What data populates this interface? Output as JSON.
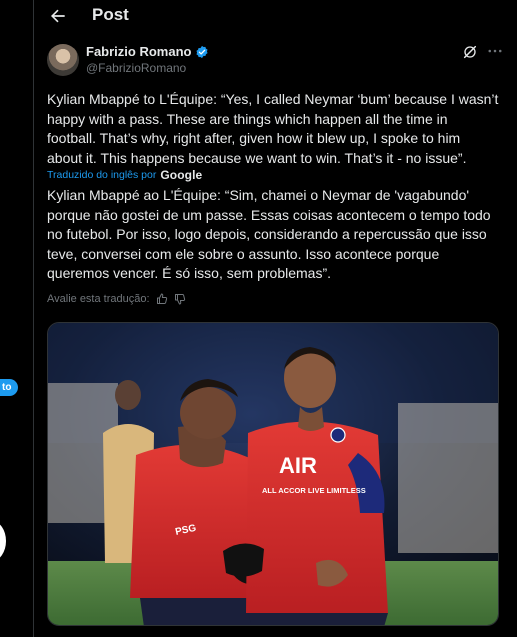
{
  "header": {
    "title": "Post"
  },
  "tweet": {
    "author_name": "Fabrizio Romano",
    "author_handle": "@FabrizioRomano",
    "text_lines": [
      "Kylian Mbappé to L'Équipe: “Yes, I called Neymar ‘bum’ because I wasn’t",
      "happy with a pass. These are things which happen all the time in",
      "football. That’s why, right after, given how it blew up, I spoke to him",
      "about it. This happens because we want to win. That’s it - no issue”."
    ],
    "translated_label": "Traduzido do inglês por",
    "translator": "Google",
    "translated_lines": [
      "Kylian Mbappé ao L'Équipe: “Sim, chamei o Neymar de 'vagabundo'",
      "porque não gostei de um passe. Essas coisas acontecem o tempo todo",
      "no futebol. Por isso, logo depois, considerando a repercussão que isso",
      "teve, conversei com ele sobre o assunto. Isso acontece porque",
      "queremos vencer. É só isso, sem problemas”."
    ],
    "rate_label": "Avalie esta tradução:",
    "media": {
      "shirt_brand": "AIR",
      "shirt_sponsor": "ALL ACCOR LIVE LIMITLESS"
    }
  },
  "rail": {
    "pill_text": "to"
  },
  "colors": {
    "background": "#000000",
    "text": "#e7e9ea",
    "muted": "#71767b",
    "accent": "#1d9bf0",
    "border": "#2f3336"
  }
}
